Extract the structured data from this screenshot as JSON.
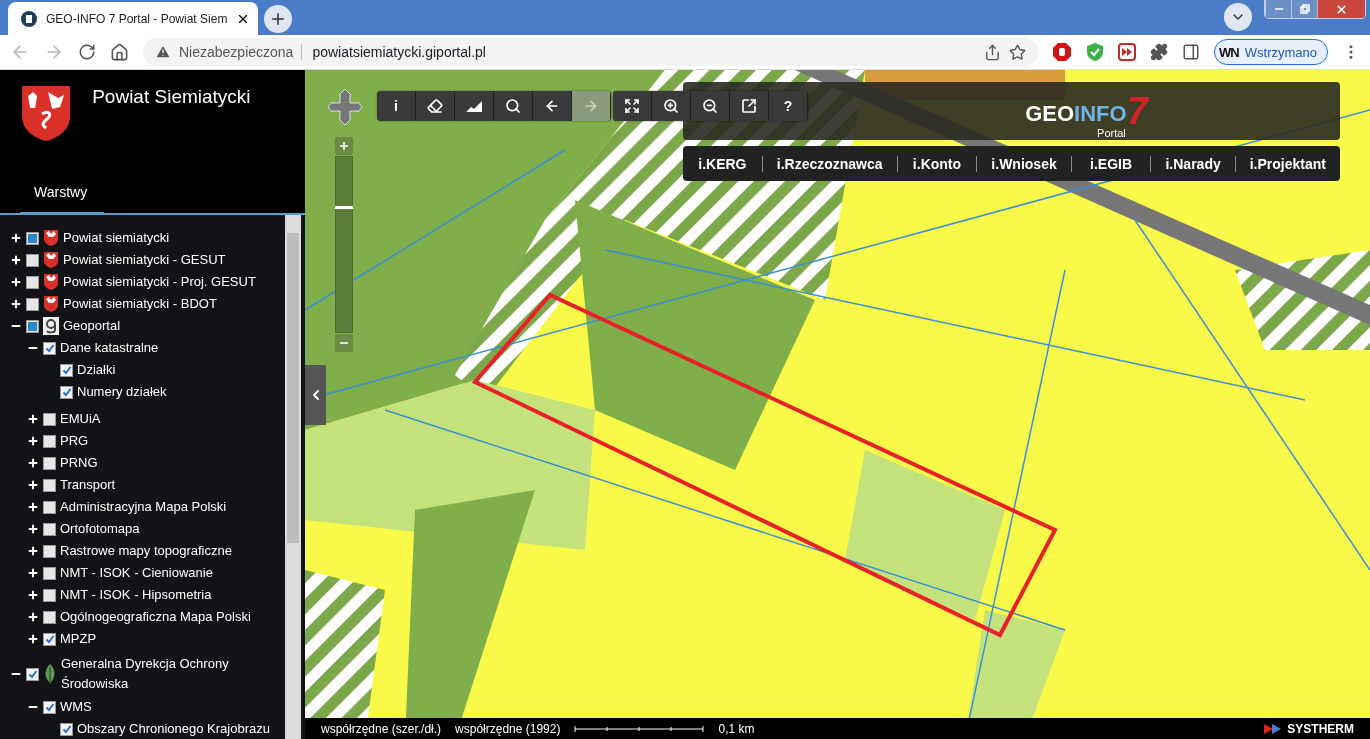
{
  "browser": {
    "tab_title": "GEO-INFO 7 Portal - Powiat Siem",
    "security": "Niezabezpieczona",
    "url": "powiatsiemiatycki.giportal.pl",
    "profile": {
      "initials": "WN",
      "label": "Wstrzymano"
    }
  },
  "sidebar": {
    "title": "Powiat Siemiatycki",
    "tabs": [
      {
        "label": "Warstwy",
        "selected": true
      }
    ],
    "layers": [
      {
        "label": "Powiat siemiatycki",
        "kind": "crest",
        "checked": false,
        "partial": true,
        "expanded": false
      },
      {
        "label": "Powiat siemiatycki - GESUT",
        "kind": "crest",
        "checked": false,
        "partial": false,
        "expanded": false
      },
      {
        "label": "Powiat siemiatycki - Proj. GESUT",
        "kind": "crest",
        "checked": false,
        "partial": false,
        "expanded": false
      },
      {
        "label": "Powiat siemiatycki - BDOT",
        "kind": "crest",
        "checked": false,
        "partial": false,
        "expanded": false
      },
      {
        "label": "Geoportal",
        "kind": "geoportal",
        "checked": false,
        "partial": true,
        "expanded": true,
        "children": [
          {
            "label": "Dane katastralne",
            "checked": true,
            "partial": false,
            "expanded": true,
            "children": [
              {
                "label": "Działki",
                "checked": true,
                "partial": false
              },
              {
                "label": "Numery działek",
                "checked": true,
                "partial": false
              }
            ]
          },
          {
            "label": "EMUiA",
            "checked": false,
            "partial": false,
            "expanded": false
          },
          {
            "label": "PRG",
            "checked": false,
            "partial": false,
            "expanded": false
          },
          {
            "label": "PRNG",
            "checked": false,
            "partial": false,
            "expanded": false
          },
          {
            "label": "Transport",
            "checked": false,
            "partial": false,
            "expanded": false
          },
          {
            "label": "Administracyjna Mapa Polski",
            "checked": false,
            "partial": false,
            "expanded": false
          },
          {
            "label": "Ortofotomapa",
            "checked": false,
            "partial": false,
            "expanded": false
          },
          {
            "label": "Rastrowe mapy topograficzne",
            "checked": false,
            "partial": false,
            "expanded": false
          },
          {
            "label": "NMT - ISOK - Cieniowanie",
            "checked": false,
            "partial": false,
            "expanded": false
          },
          {
            "label": "NMT - ISOK - Hipsometria",
            "checked": false,
            "partial": false,
            "expanded": false
          },
          {
            "label": "Ogólnogeograficzna Mapa Polski",
            "checked": false,
            "partial": false,
            "expanded": false
          },
          {
            "label": "MPZP",
            "checked": true,
            "partial": false,
            "expanded": false
          }
        ]
      },
      {
        "label": "Generalna Dyrekcja Ochrony Środowiska",
        "kind": "nature",
        "checked": true,
        "partial": false,
        "expanded": true,
        "children": [
          {
            "label": "WMS",
            "checked": true,
            "partial": false,
            "expanded": true,
            "children": [
              {
                "label": "Obszary Chronionego Krajobrazu",
                "checked": true,
                "partial": false
              }
            ]
          }
        ]
      }
    ]
  },
  "map": {
    "zoom": {
      "level": 0.72
    },
    "toolbar": [
      [
        {
          "label": "i",
          "disabled": false
        },
        {
          "kind": "eraser",
          "disabled": false
        },
        {
          "kind": "profile",
          "disabled": false
        },
        {
          "kind": "search",
          "disabled": false
        },
        {
          "kind": "back",
          "disabled": false
        },
        {
          "kind": "forward",
          "disabled": true
        }
      ],
      [
        {
          "kind": "extent",
          "disabled": false
        },
        {
          "kind": "zoom-in",
          "disabled": false
        },
        {
          "kind": "zoom-out",
          "disabled": false
        },
        {
          "kind": "export",
          "disabled": false
        },
        {
          "label": "?",
          "disabled": false
        }
      ]
    ],
    "logo": {
      "parts": [
        "GEO",
        "INFO",
        "7"
      ],
      "subtitle": "Portal"
    },
    "links": [
      "i.KERG",
      "i.Rzeczoznawca",
      "i.Konto",
      "i.Wniosek",
      "i.EGIB",
      "i.Narady",
      "i.Projektant"
    ],
    "status": {
      "coords_geo": "współrzędne (szer./dł.)",
      "coords_1992": "współrzędne (1992)",
      "scale": "0,1 km",
      "brand": "SYSTHERM"
    }
  }
}
